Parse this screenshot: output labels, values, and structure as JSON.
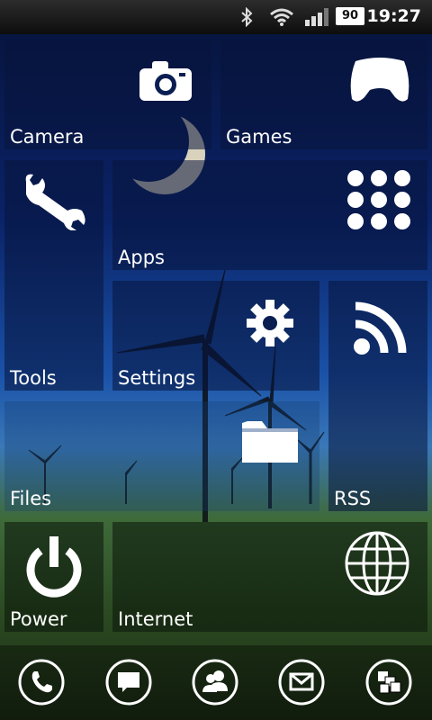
{
  "statusbar": {
    "time": "19:27",
    "battery": "90",
    "icons": [
      "bluetooth-icon",
      "wifi-icon",
      "signal-icon",
      "battery-icon"
    ]
  },
  "tiles": {
    "camera": "Camera",
    "games": "Games",
    "tools": "Tools",
    "apps": "Apps",
    "settings": "Settings",
    "rss": "RSS",
    "files": "Files",
    "power": "Power",
    "internet": "Internet"
  },
  "dock": {
    "icons": [
      "phone-icon",
      "messages-icon",
      "contacts-icon",
      "email-icon",
      "windows-icon"
    ]
  },
  "colors": {
    "tile_bg": "#0a1e52",
    "tile_text": "#ffffff",
    "statusbar_bg": "#1a1a1a"
  }
}
